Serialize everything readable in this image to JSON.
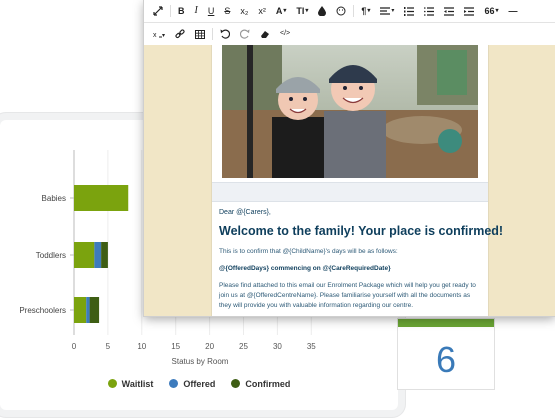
{
  "chart_data": {
    "type": "bar",
    "orientation": "horizontal",
    "stacked": true,
    "categories": [
      "Babies",
      "Toddlers",
      "Preschoolers"
    ],
    "series": [
      {
        "name": "Waitlist",
        "color": "#7ba30e",
        "values": [
          8,
          3,
          1.8
        ]
      },
      {
        "name": "Offered",
        "color": "#3d7bbd",
        "values": [
          0,
          1,
          0.5
        ]
      },
      {
        "name": "Confirmed",
        "color": "#3e5e14",
        "values": [
          0,
          1,
          1.4
        ]
      }
    ],
    "xlabel": "Status by Room",
    "x_ticks": [
      "0",
      "5",
      "10",
      "15",
      "20",
      "25",
      "30",
      "35"
    ],
    "xlim": [
      0,
      35
    ],
    "grid": true,
    "legend_position": "bottom-center"
  },
  "calendar": {
    "value": "6"
  },
  "toolbar": {
    "row1": [
      "expand-icon",
      "bold-button",
      "italic-button",
      "underline-button",
      "strikethrough-button",
      "subscript-button",
      "superscript-button",
      "font-color-button",
      "font-size-button",
      "ink-icon",
      "emoji-icon",
      "paragraph-button",
      "align-button",
      "ordered-list-button",
      "unordered-list-button",
      "outdent-button",
      "indent-button",
      "quote-button",
      "horizontal-rule-button"
    ],
    "labels": {
      "bold": "B",
      "italic": "I",
      "underline": "U",
      "strike": "S",
      "sub": "x₂",
      "sup": "x²",
      "fontcolor": "A",
      "fontsize": "TI",
      "paragraph": "¶",
      "quote": "66",
      "hr": "—",
      "code": "</>"
    }
  },
  "email": {
    "salutation": "Dear @{Carers},",
    "headline": "Welcome to the family! Your place is confirmed!",
    "line1": "This is to confirm that @{ChildName}'s days will be as follows:",
    "line2": "@{OfferedDays} commencing on @{CareRequiredDate}",
    "line3": "Please find attached to this email our Enrolment Package which will help you get ready to join us at @{OfferedCentreName}. Please familiarise yourself with all the documents as they will provide you with valuable information regarding our centre."
  }
}
